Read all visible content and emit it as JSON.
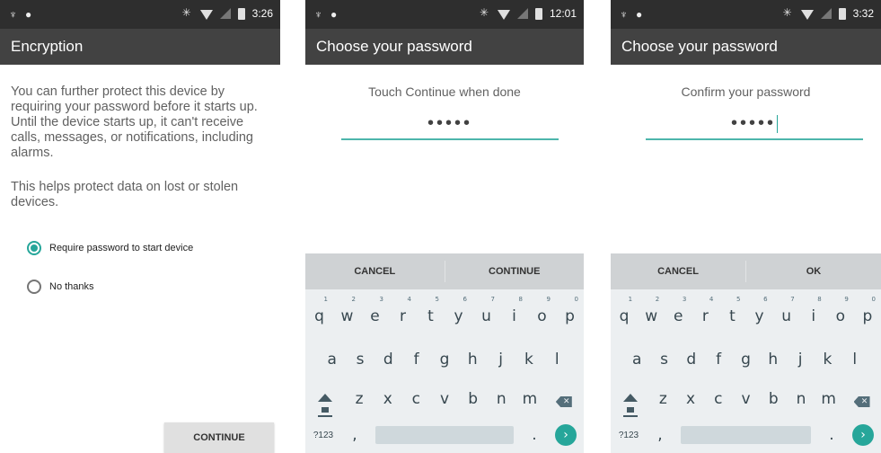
{
  "screens": [
    {
      "status": {
        "time": "3:26"
      },
      "title": "Encryption",
      "paragraph1": "You can further protect this device by requiring your password before it starts up. Until the device starts up, it can't receive calls, messages, or notifications, including alarms.",
      "paragraph2": "This helps protect data on lost or stolen devices.",
      "options": [
        {
          "label": "Require password to start device",
          "selected": true
        },
        {
          "label": "No thanks",
          "selected": false
        }
      ],
      "continue_label": "CONTINUE"
    },
    {
      "status": {
        "time": "12:01"
      },
      "title": "Choose your password",
      "hint": "Touch Continue when done",
      "password_mask": "•••••",
      "left_action": "CANCEL",
      "right_action": "CONTINUE"
    },
    {
      "status": {
        "time": "3:32"
      },
      "title": "Choose your password",
      "hint": "Confirm your password",
      "password_mask": "•••••",
      "left_action": "CANCEL",
      "right_action": "OK"
    }
  ],
  "keyboard": {
    "row1": [
      {
        "k": "q",
        "n": "1"
      },
      {
        "k": "w",
        "n": "2"
      },
      {
        "k": "e",
        "n": "3"
      },
      {
        "k": "r",
        "n": "4"
      },
      {
        "k": "t",
        "n": "5"
      },
      {
        "k": "y",
        "n": "6"
      },
      {
        "k": "u",
        "n": "7"
      },
      {
        "k": "i",
        "n": "8"
      },
      {
        "k": "o",
        "n": "9"
      },
      {
        "k": "p",
        "n": "0"
      }
    ],
    "row2": [
      "a",
      "s",
      "d",
      "f",
      "g",
      "h",
      "j",
      "k",
      "l"
    ],
    "row3": [
      "z",
      "x",
      "c",
      "v",
      "b",
      "n",
      "m"
    ],
    "symbols_key": "?123",
    "comma_key": ",",
    "period_key": ".",
    "go_glyph": "›"
  },
  "colors": {
    "accent": "#26a69a",
    "appbar": "#424242",
    "statusbar": "#2e2e2e"
  },
  "icons": [
    "usb-icon",
    "notification-icon",
    "bluetooth-icon",
    "wifi-icon",
    "signal-icon",
    "battery-icon",
    "shift-icon",
    "backspace-icon"
  ]
}
